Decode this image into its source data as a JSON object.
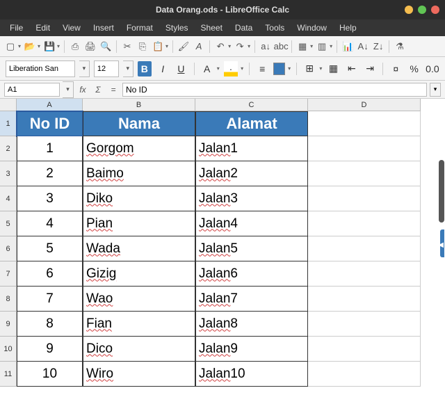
{
  "window": {
    "title": "Data Orang.ods - LibreOffice Calc"
  },
  "menu": {
    "items": [
      "File",
      "Edit",
      "View",
      "Insert",
      "Format",
      "Styles",
      "Sheet",
      "Data",
      "Tools",
      "Window",
      "Help"
    ]
  },
  "formatting": {
    "font_name": "Liberation San",
    "font_size": "12",
    "bold_active": true
  },
  "formula_bar": {
    "cell_ref": "A1",
    "content": "No ID"
  },
  "columns": [
    "A",
    "B",
    "C",
    "D"
  ],
  "rows": [
    "1",
    "2",
    "3",
    "4",
    "5",
    "6",
    "7",
    "8",
    "9",
    "10",
    "11"
  ],
  "table": {
    "headers": [
      "No ID",
      "Nama",
      "Alamat"
    ],
    "rows": [
      {
        "id": "1",
        "nama": "Gorgom",
        "alamat": "Jalan 1"
      },
      {
        "id": "2",
        "nama": "Baimo",
        "alamat": "Jalan 2"
      },
      {
        "id": "3",
        "nama": "Diko",
        "alamat": "Jalan 3"
      },
      {
        "id": "4",
        "nama": "Pian",
        "alamat": "Jalan 4"
      },
      {
        "id": "5",
        "nama": "Wada",
        "alamat": "Jalan 5"
      },
      {
        "id": "6",
        "nama": "Gizig",
        "alamat": "Jalan 6"
      },
      {
        "id": "7",
        "nama": "Wao",
        "alamat": "Jalan 7"
      },
      {
        "id": "8",
        "nama": "Fian",
        "alamat": "Jalan 8"
      },
      {
        "id": "9",
        "nama": "Dico",
        "alamat": "Jalan 9"
      },
      {
        "id": "10",
        "nama": "Wiro",
        "alamat": "Jalan 10"
      }
    ]
  }
}
